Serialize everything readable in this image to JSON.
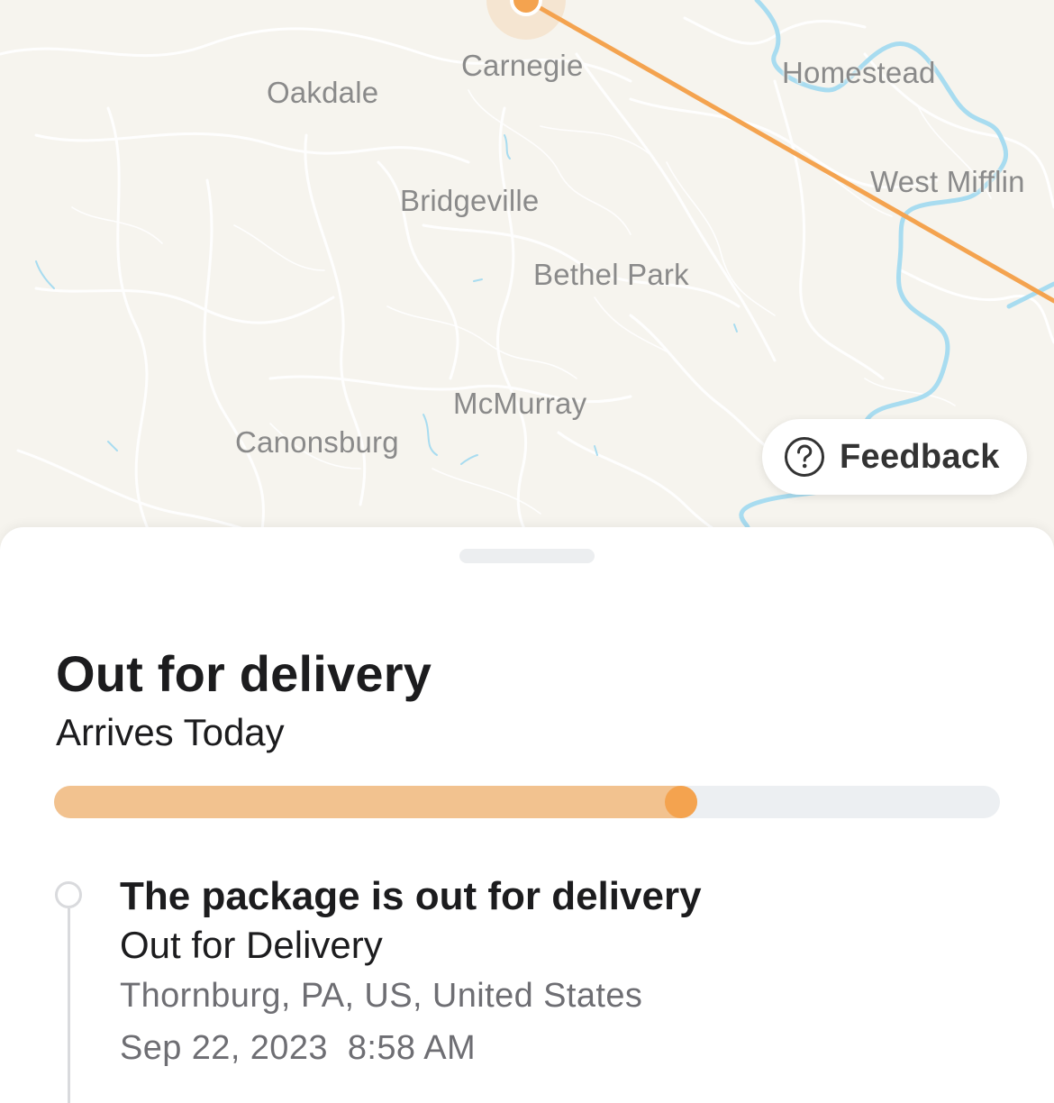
{
  "map": {
    "labels": [
      {
        "id": "carnegie",
        "text": "Carnegie"
      },
      {
        "id": "oakdale",
        "text": "Oakdale"
      },
      {
        "id": "homestead",
        "text": "Homestead"
      },
      {
        "id": "west-mifflin",
        "text": "West Mifflin"
      },
      {
        "id": "bridgeville",
        "text": "Bridgeville"
      },
      {
        "id": "bethel-park",
        "text": "Bethel Park"
      },
      {
        "id": "mcmurray",
        "text": "McMurray"
      },
      {
        "id": "canonsburg",
        "text": "Canonsburg"
      }
    ],
    "route_color": "#f4a34f",
    "water_color": "#a8dcf0",
    "feedback_label": "Feedback",
    "feedback_icon": "question-circle-icon"
  },
  "sheet": {
    "status_title": "Out for delivery",
    "status_subtitle": "Arrives Today",
    "progress_fraction": 0.68,
    "progress_color": "#f2c28f",
    "progress_knob_color": "#f4a34f"
  },
  "events": [
    {
      "title": "The package is out for delivery",
      "status": "Out for Delivery",
      "location": "Thornburg, PA, US, United States",
      "date": "Sep 22, 2023",
      "time": "8:58 AM"
    }
  ]
}
